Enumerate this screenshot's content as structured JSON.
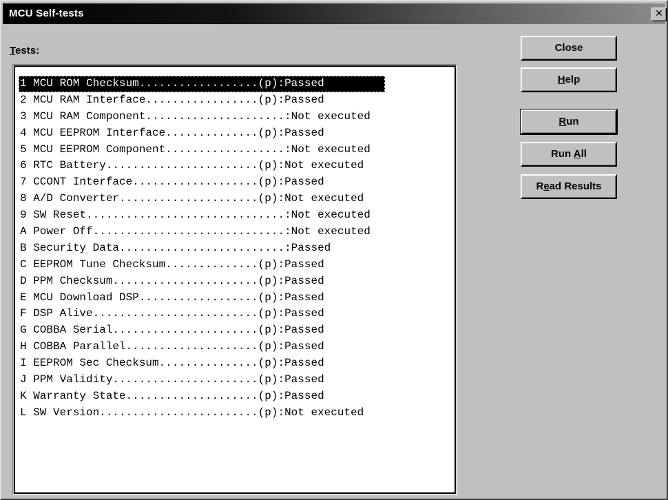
{
  "window": {
    "title": "MCU Self-tests",
    "close_glyph": "✕"
  },
  "tests_label": {
    "mnemonic": "T",
    "rest": "ests:"
  },
  "tests": [
    {
      "text": "1 MCU ROM Checksum..................(p):Passed",
      "selected": true
    },
    {
      "text": "2 MCU RAM Interface.................(p):Passed"
    },
    {
      "text": "3 MCU RAM Component.....................:Not executed"
    },
    {
      "text": "4 MCU EEPROM Interface..............(p):Passed"
    },
    {
      "text": "5 MCU EEPROM Component..................:Not executed"
    },
    {
      "text": "6 RTC Battery.......................(p):Not executed"
    },
    {
      "text": "7 CCONT Interface...................(p):Passed"
    },
    {
      "text": "8 A/D Converter.....................(p):Not executed"
    },
    {
      "text": "9 SW Reset..............................:Not executed"
    },
    {
      "text": "A Power Off.............................:Not executed"
    },
    {
      "text": "B Security Data.........................:Passed"
    },
    {
      "text": "C EEPROM Tune Checksum..............(p):Passed"
    },
    {
      "text": "D PPM Checksum......................(p):Passed"
    },
    {
      "text": "E MCU Download DSP..................(p):Passed"
    },
    {
      "text": "F DSP Alive.........................(p):Passed"
    },
    {
      "text": "G COBBA Serial......................(p):Passed"
    },
    {
      "text": "H COBBA Parallel....................(p):Passed"
    },
    {
      "text": "I EEPROM Sec Checksum...............(p):Passed"
    },
    {
      "text": "J PPM Validity......................(p):Passed"
    },
    {
      "text": "K Warranty State....................(p):Passed"
    },
    {
      "text": "L SW Version........................(p):Not executed"
    }
  ],
  "buttons": {
    "close": {
      "label": "Close"
    },
    "help": {
      "mnemonic": "H",
      "rest": "elp"
    },
    "run": {
      "mnemonic": "R",
      "rest": "un"
    },
    "run_all": {
      "pre": "Run ",
      "mnemonic": "A",
      "rest": "ll"
    },
    "read_results": {
      "mnemonic": "R",
      "pre_mid": "",
      "mid_mnemonic": "e",
      "rest": "ad Results"
    }
  }
}
